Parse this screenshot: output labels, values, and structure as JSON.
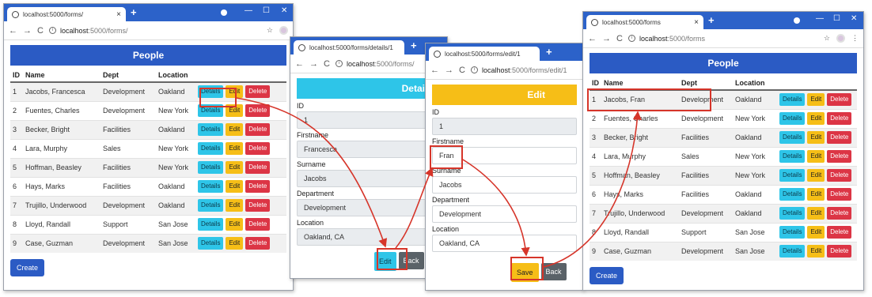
{
  "colors": {
    "primary": "#2b5bc4",
    "info": "#2ec5e8",
    "warning": "#f6be17",
    "danger": "#dc3545",
    "highlight": "#d6352a"
  },
  "list_window": {
    "tab_title": "localhost:5000/forms/",
    "url_host": "localhost",
    "url_rest": ":5000/forms/",
    "banner": "People",
    "columns": [
      "ID",
      "Name",
      "Dept",
      "Location"
    ],
    "rows": [
      {
        "id": "1",
        "name": "Jacobs, Francesca",
        "dept": "Development",
        "location": "Oakland"
      },
      {
        "id": "2",
        "name": "Fuentes, Charles",
        "dept": "Development",
        "location": "New York"
      },
      {
        "id": "3",
        "name": "Becker, Bright",
        "dept": "Facilities",
        "location": "Oakland"
      },
      {
        "id": "4",
        "name": "Lara, Murphy",
        "dept": "Sales",
        "location": "New York"
      },
      {
        "id": "5",
        "name": "Hoffman, Beasley",
        "dept": "Facilities",
        "location": "New York"
      },
      {
        "id": "6",
        "name": "Hays, Marks",
        "dept": "Facilities",
        "location": "Oakland"
      },
      {
        "id": "7",
        "name": "Trujillo, Underwood",
        "dept": "Development",
        "location": "Oakland"
      },
      {
        "id": "8",
        "name": "Lloyd, Randall",
        "dept": "Support",
        "location": "San Jose"
      },
      {
        "id": "9",
        "name": "Case, Guzman",
        "dept": "Development",
        "location": "San Jose"
      }
    ],
    "buttons": {
      "details": "Details",
      "edit": "Edit",
      "delete": "Delete",
      "create": "Create"
    }
  },
  "details_window": {
    "tab_title": "localhost:5000/forms/details/1",
    "url_host": "localhost",
    "url_rest": ":5000/forms/",
    "banner": "Details",
    "fields": [
      {
        "label": "ID",
        "value": "1"
      },
      {
        "label": "Firstname",
        "value": "Francesca"
      },
      {
        "label": "Surname",
        "value": "Jacobs"
      },
      {
        "label": "Department",
        "value": "Development"
      },
      {
        "label": "Location",
        "value": "Oakland, CA"
      }
    ],
    "edit_button": "Edit",
    "back_button": "Back"
  },
  "edit_window": {
    "tab_title": "localhost:5000/forms/edit/1",
    "url_host": "localhost",
    "url_rest": ":5000/forms/edit/1",
    "banner": "Edit",
    "fields": [
      {
        "label": "ID",
        "value": "1"
      },
      {
        "label": "Firstname",
        "value": "Fran"
      },
      {
        "label": "Surname",
        "value": "Jacobs"
      },
      {
        "label": "Department",
        "value": "Development"
      },
      {
        "label": "Location",
        "value": "Oakland, CA"
      }
    ],
    "save_button": "Save",
    "back_button": "Back"
  },
  "result_window": {
    "tab_title": "localhost:5000/forms",
    "url_host": "localhost",
    "url_rest": ":5000/forms",
    "banner": "People",
    "columns": [
      "ID",
      "Name",
      "Dept",
      "Location"
    ],
    "rows": [
      {
        "id": "1",
        "name": "Jacobs, Fran",
        "dept": "Development",
        "location": "Oakland"
      },
      {
        "id": "2",
        "name": "Fuentes, Charles",
        "dept": "Development",
        "location": "New York"
      },
      {
        "id": "3",
        "name": "Becker, Bright",
        "dept": "Facilities",
        "location": "Oakland"
      },
      {
        "id": "4",
        "name": "Lara, Murphy",
        "dept": "Sales",
        "location": "New York"
      },
      {
        "id": "5",
        "name": "Hoffman, Beasley",
        "dept": "Facilities",
        "location": "New York"
      },
      {
        "id": "6",
        "name": "Hays, Marks",
        "dept": "Facilities",
        "location": "Oakland"
      },
      {
        "id": "7",
        "name": "Trujillo, Underwood",
        "dept": "Development",
        "location": "Oakland"
      },
      {
        "id": "8",
        "name": "Lloyd, Randall",
        "dept": "Support",
        "location": "San Jose"
      },
      {
        "id": "9",
        "name": "Case, Guzman",
        "dept": "Development",
        "location": "San Jose"
      }
    ],
    "buttons": {
      "details": "Details",
      "edit": "Edit",
      "delete": "Delete",
      "create": "Create"
    }
  }
}
